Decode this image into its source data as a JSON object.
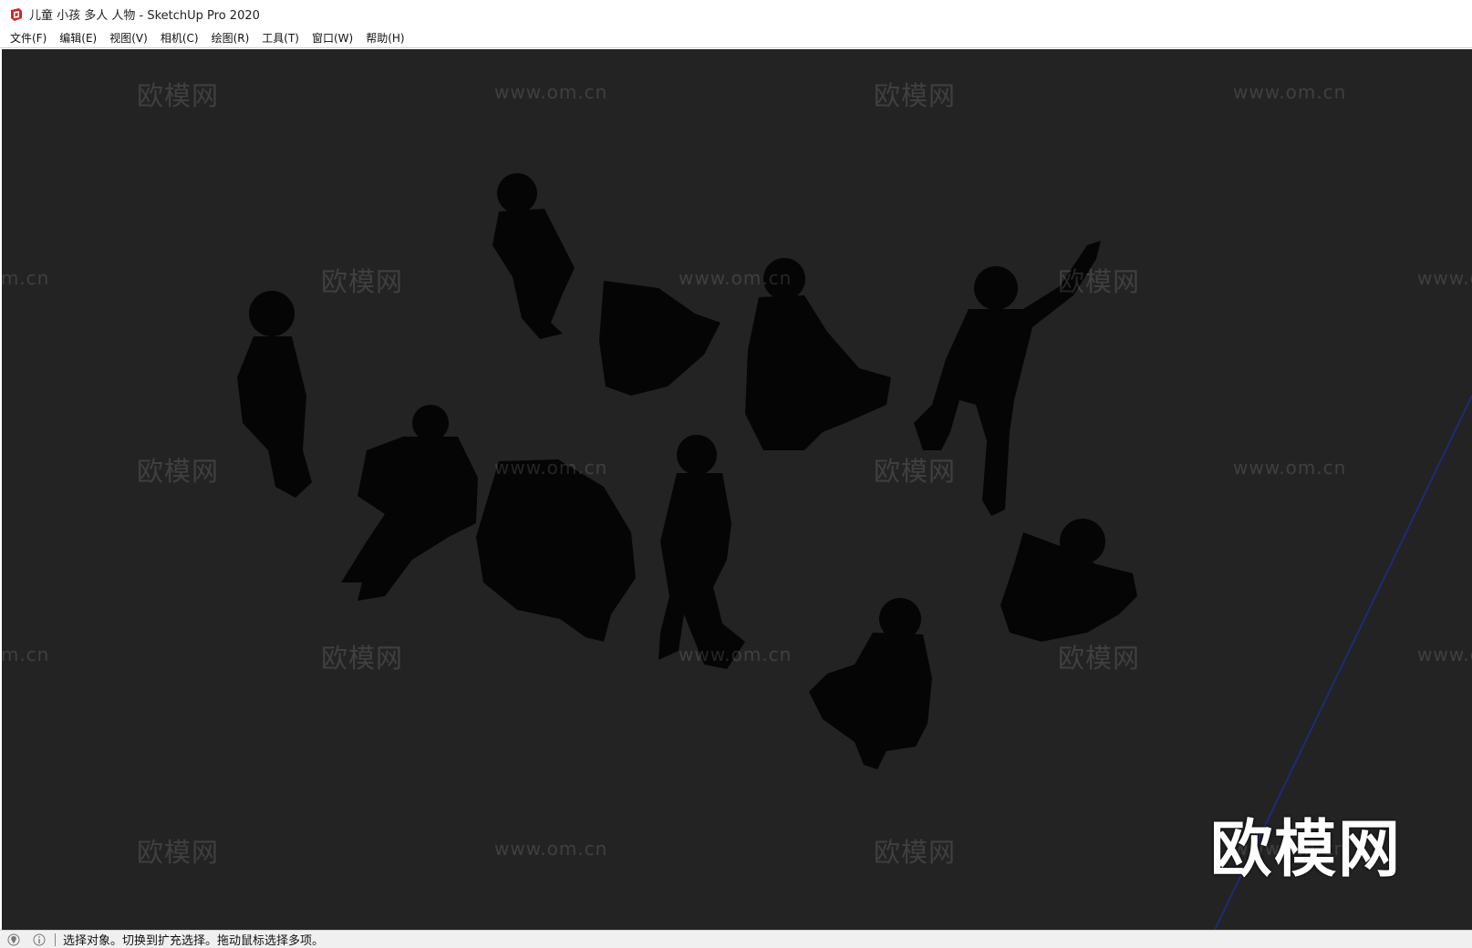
{
  "window": {
    "title": "儿童 小孩 多人 人物 - SketchUp Pro 2020",
    "app_icon": "sketchup-logo-icon"
  },
  "menubar": {
    "items": [
      {
        "label": "文件(F)"
      },
      {
        "label": "编辑(E)"
      },
      {
        "label": "视图(V)"
      },
      {
        "label": "相机(C)"
      },
      {
        "label": "绘图(R)"
      },
      {
        "label": "工具(T)"
      },
      {
        "label": "窗口(W)"
      },
      {
        "label": "帮助(H)"
      }
    ]
  },
  "viewport": {
    "background_color": "#232323",
    "axis_color": "#1f2a7a",
    "watermark_text": "欧模网",
    "watermark_url": "www.om.cn",
    "logo_text": "欧模网"
  },
  "statusbar": {
    "icons": [
      "geo-location-icon",
      "info-icon"
    ],
    "message": "选择对象。切换到扩充选择。拖动鼠标选择多项。"
  }
}
